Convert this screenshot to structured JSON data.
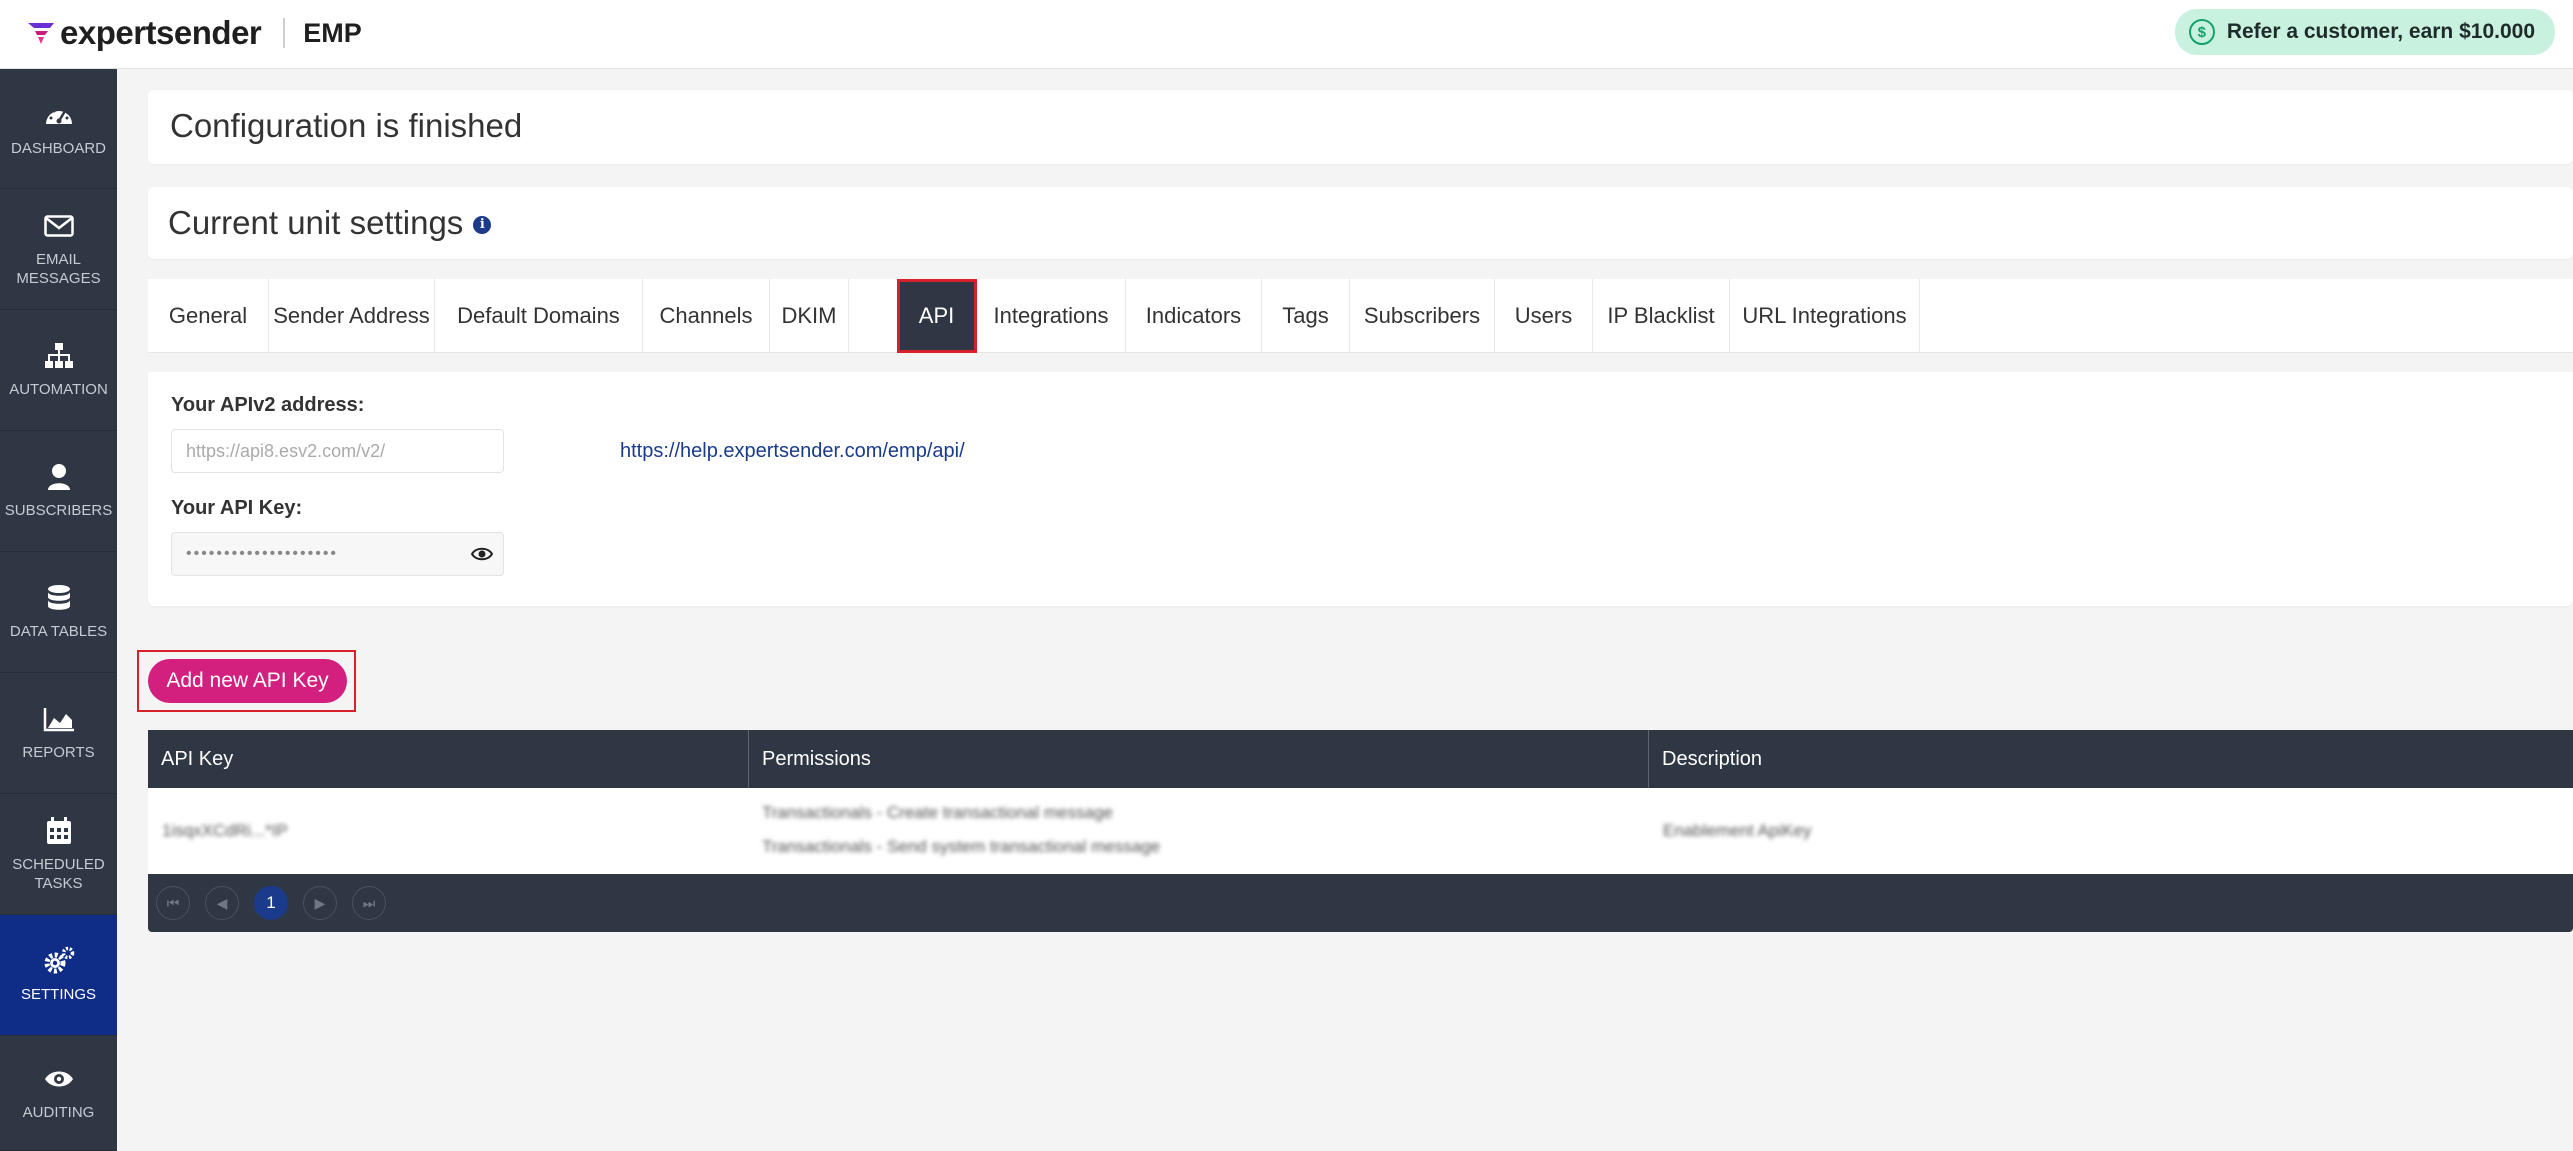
{
  "header": {
    "brand": "expertsender",
    "app": "EMP",
    "refer_icon": "dollar-circle-icon",
    "refer_text": "Refer a customer, earn $10.000"
  },
  "sidebar": {
    "items": [
      {
        "label": "DASHBOARD",
        "icon": "dashboard-gauge-icon"
      },
      {
        "label": "EMAIL\nMESSAGES",
        "icon": "envelope-icon"
      },
      {
        "label": "AUTOMATION",
        "icon": "sitemap-icon"
      },
      {
        "label": "SUBSCRIBERS",
        "icon": "user-icon"
      },
      {
        "label": "DATA TABLES",
        "icon": "database-icon"
      },
      {
        "label": "REPORTS",
        "icon": "area-chart-icon"
      },
      {
        "label": "SCHEDULED\nTASKS",
        "icon": "calendar-icon"
      },
      {
        "label": "SETTINGS",
        "icon": "cogs-icon"
      },
      {
        "label": "AUDITING",
        "icon": "eye-icon"
      }
    ],
    "active": "SETTINGS"
  },
  "config": {
    "title": "Configuration is finished"
  },
  "unit": {
    "title": "Current unit settings",
    "info_icon": "info-icon"
  },
  "tabs": [
    "General",
    "Sender Address",
    "Default Domains",
    "Channels",
    "DKIM",
    "API",
    "Integrations",
    "Indicators",
    "Tags",
    "Subscribers",
    "Users",
    "IP Blacklist",
    "URL Integrations"
  ],
  "active_tab": "API",
  "api": {
    "address_label": "Your APIv2 address:",
    "address_value": "https://api8.esv2.com/v2/",
    "key_label": "Your API Key:",
    "key_value": "••••••••••••••••••••",
    "help_link": "https://help.expertsender.com/emp/api/",
    "add_button": "Add new API Key"
  },
  "table": {
    "columns": [
      "API Key",
      "Permissions",
      "Description"
    ],
    "rows": [
      {
        "key": "1isqxXCdRi...*IP",
        "permissions": [
          "Transactionals - Create transactional message",
          "Transactionals - Send system transactional message"
        ],
        "description": "Enablement ApiKey"
      }
    ],
    "pagination": {
      "current_page": "1"
    }
  }
}
